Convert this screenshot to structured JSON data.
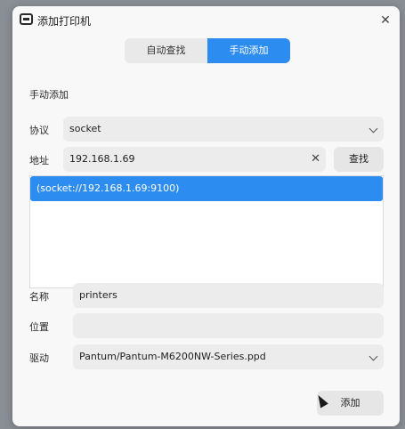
{
  "window": {
    "title": "添加打印机"
  },
  "tabs": [
    {
      "label": "自动查找",
      "active": false
    },
    {
      "label": "手动添加",
      "active": true
    }
  ],
  "section": {
    "title": "手动添加"
  },
  "protocol": {
    "label": "协议",
    "value": "socket"
  },
  "address": {
    "label": "地址",
    "value": "192.168.1.69",
    "search_label": "查找"
  },
  "results": [
    "(socket://192.168.1.69:9100)"
  ],
  "name": {
    "label": "名称",
    "value": "printers"
  },
  "location": {
    "label": "位置",
    "value": ""
  },
  "driver": {
    "label": "驱动",
    "value": "Pantum/Pantum-M6200NW-Series.ppd"
  },
  "actions": {
    "add_label": "添加"
  },
  "colors": {
    "accent": "#2d8cf0"
  }
}
